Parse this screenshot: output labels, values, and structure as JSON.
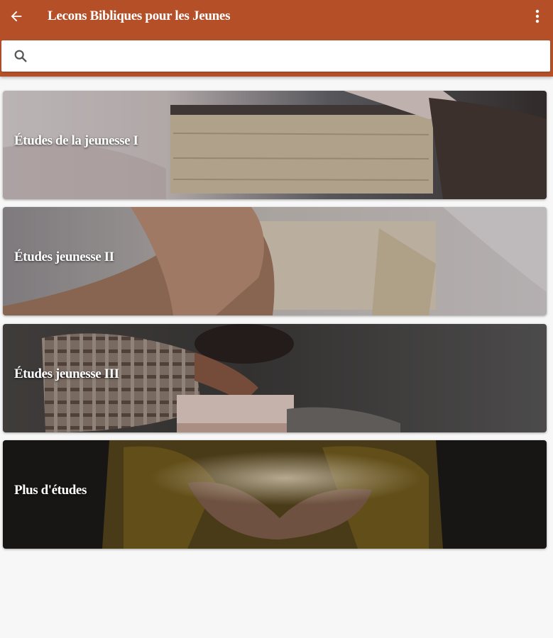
{
  "appbar": {
    "title": "Lecons Bibliques pour les Jeunes",
    "back_icon": "arrow-left-icon",
    "menu_icon": "more-vert-icon",
    "color": "#b44f28"
  },
  "search": {
    "icon": "search-icon",
    "value": "",
    "placeholder": ""
  },
  "cards": [
    {
      "label": "Études de la jeunesse I"
    },
    {
      "label": "Études jeunesse II"
    },
    {
      "label": "Études jeunesse III"
    },
    {
      "label": "Plus d'études"
    }
  ]
}
